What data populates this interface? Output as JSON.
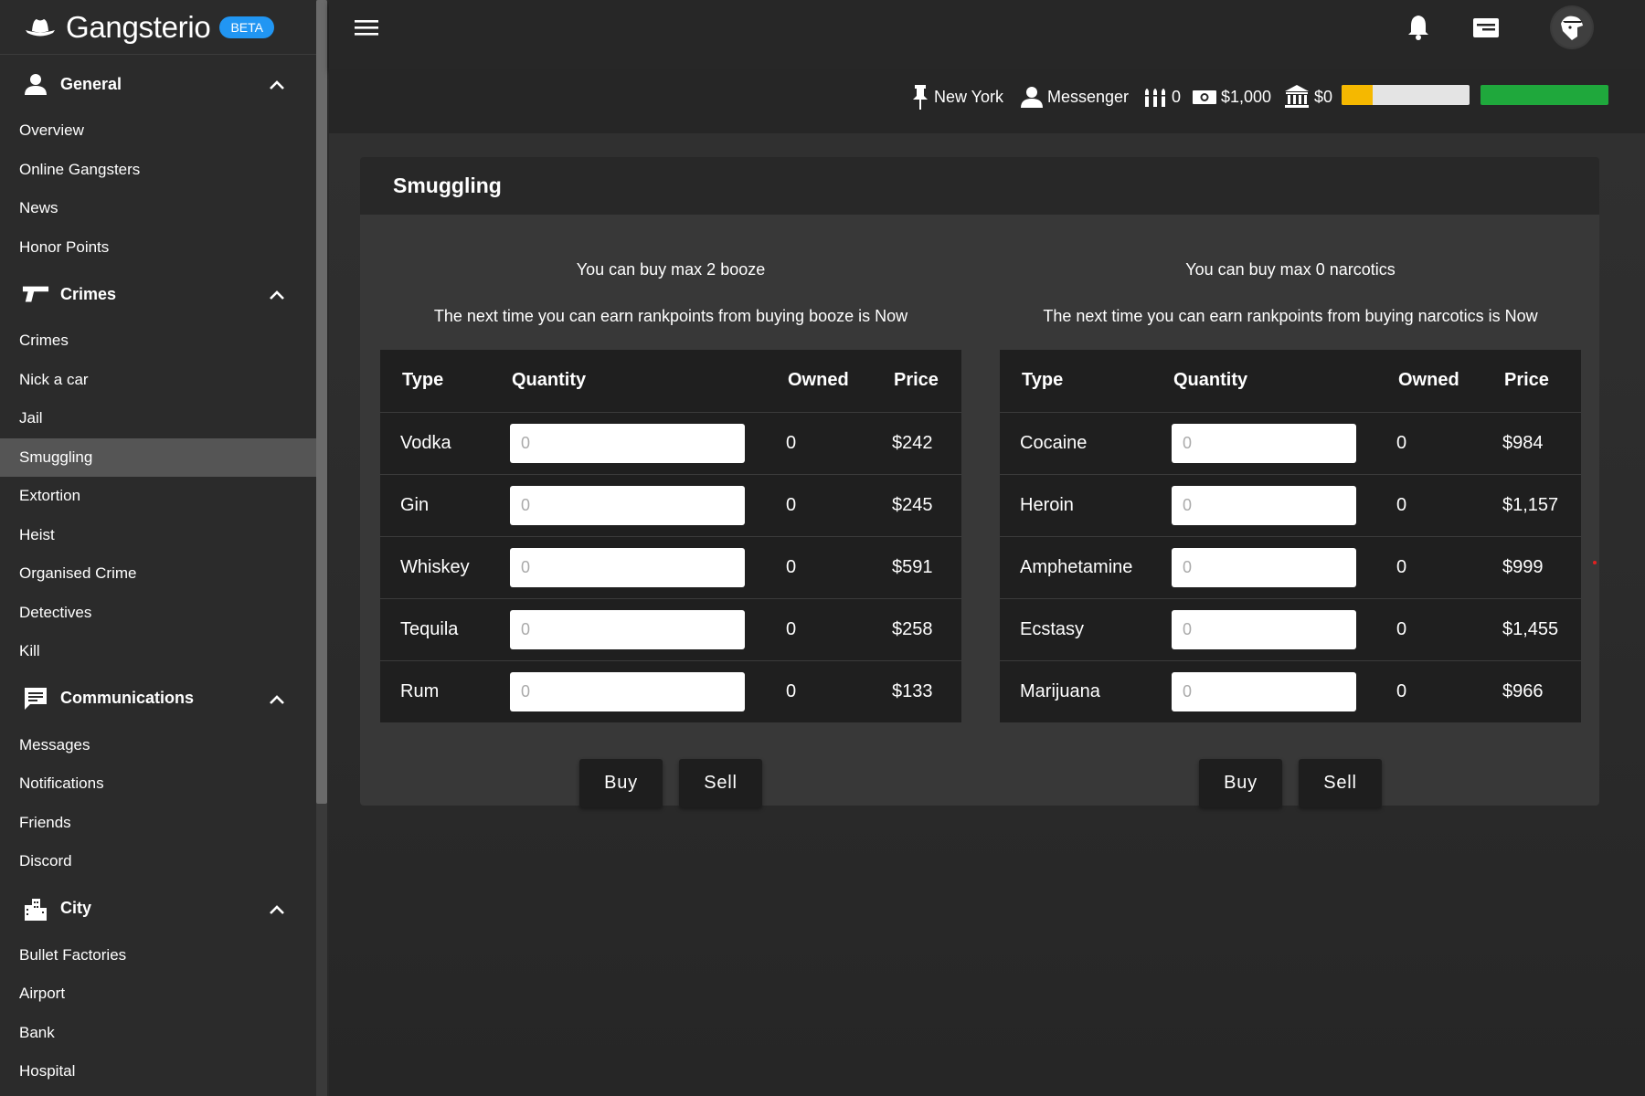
{
  "app": {
    "brand": "Gangsterio",
    "badge": "BETA",
    "accent": "#2196f3"
  },
  "sidebar": {
    "sections": [
      {
        "title": "General",
        "icon": "person-icon",
        "items": [
          "Overview",
          "Online Gangsters",
          "News",
          "Honor Points"
        ]
      },
      {
        "title": "Crimes",
        "icon": "gun-icon",
        "items": [
          "Crimes",
          "Nick a car",
          "Jail",
          "Smuggling",
          "Extortion",
          "Heist",
          "Organised Crime",
          "Detectives",
          "Kill"
        ]
      },
      {
        "title": "Communications",
        "icon": "message-icon",
        "items": [
          "Messages",
          "Notifications",
          "Friends",
          "Discord"
        ]
      },
      {
        "title": "City",
        "icon": "city-icon",
        "items": [
          "Bullet Factories",
          "Airport",
          "Bank",
          "Hospital"
        ]
      }
    ],
    "active_item": "Smuggling"
  },
  "status": {
    "city": "New York",
    "rank": "Messenger",
    "bullets": "0",
    "cash": "$1,000",
    "bank": "$0",
    "rank_progress": 0.24,
    "rank_progress_color": "#f5b800",
    "health": 1.0,
    "health_color": "#1fa83c"
  },
  "page": {
    "title": "Smuggling",
    "booze": {
      "info_max": "You can buy max 2 booze",
      "info_next": "The next time you can earn rankpoints from buying booze is Now",
      "headers": [
        "Type",
        "Quantity",
        "Owned",
        "Price"
      ],
      "rows": [
        {
          "type": "Vodka",
          "owned": "0",
          "price": "$242"
        },
        {
          "type": "Gin",
          "owned": "0",
          "price": "$245"
        },
        {
          "type": "Whiskey",
          "owned": "0",
          "price": "$591"
        },
        {
          "type": "Tequila",
          "owned": "0",
          "price": "$258"
        },
        {
          "type": "Rum",
          "owned": "0",
          "price": "$133"
        }
      ],
      "buy_label": "Buy",
      "sell_label": "Sell"
    },
    "narcotics": {
      "info_max": "You can buy max 0 narcotics",
      "info_next": "The next time you can earn rankpoints from buying narcotics is Now",
      "headers": [
        "Type",
        "Quantity",
        "Owned",
        "Price"
      ],
      "rows": [
        {
          "type": "Cocaine",
          "owned": "0",
          "price": "$984"
        },
        {
          "type": "Heroin",
          "owned": "0",
          "price": "$1,157"
        },
        {
          "type": "Amphetamine",
          "owned": "0",
          "price": "$999"
        },
        {
          "type": "Ecstasy",
          "owned": "0",
          "price": "$1,455"
        },
        {
          "type": "Marijuana",
          "owned": "0",
          "price": "$966"
        }
      ],
      "buy_label": "Buy",
      "sell_label": "Sell"
    },
    "quantity_placeholder": "0"
  }
}
